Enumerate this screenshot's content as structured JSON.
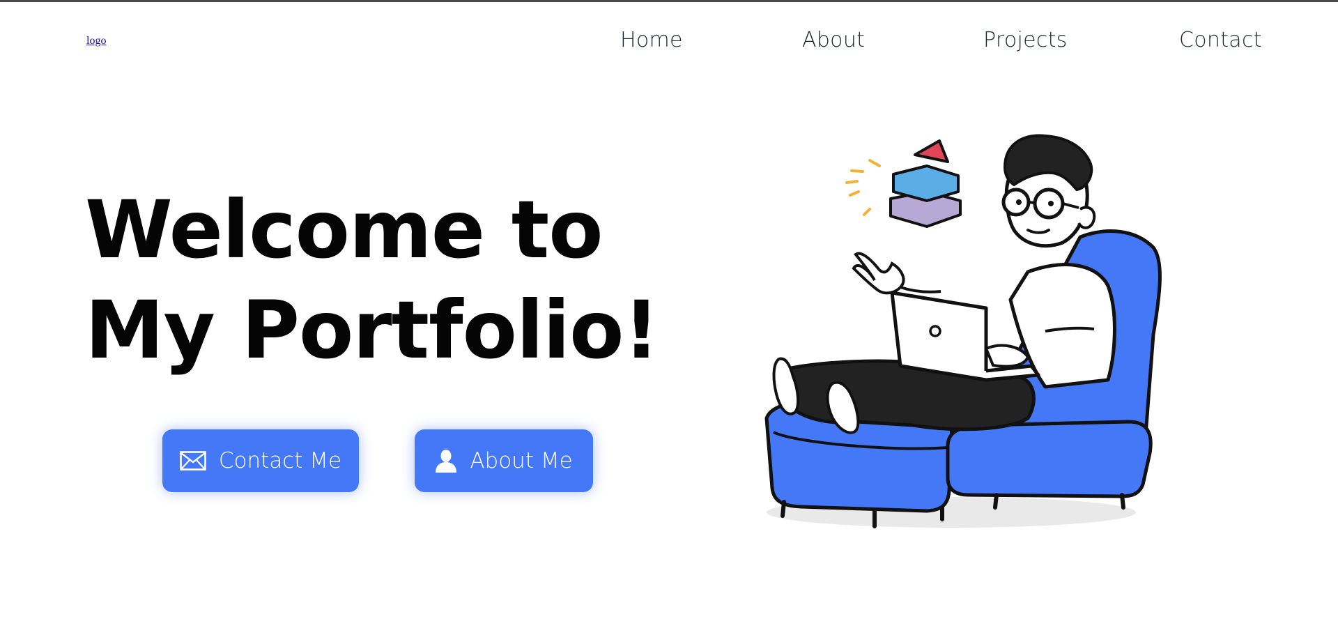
{
  "header": {
    "logo_alt": "logo",
    "nav": {
      "home": "Home",
      "about": "About",
      "projects": "Projects",
      "contact": "Contact"
    }
  },
  "hero": {
    "title_line1": "Welcome to",
    "title_line2": "My Portfolio!",
    "buttons": {
      "contact": {
        "label": "Contact Me",
        "icon": "envelope-icon"
      },
      "about": {
        "label": "About Me",
        "icon": "user-icon"
      }
    },
    "illustration": "person-with-laptop-in-armchair"
  },
  "colors": {
    "accent": "#4578f7",
    "text": "#050505",
    "nav_text": "#1f2733"
  }
}
